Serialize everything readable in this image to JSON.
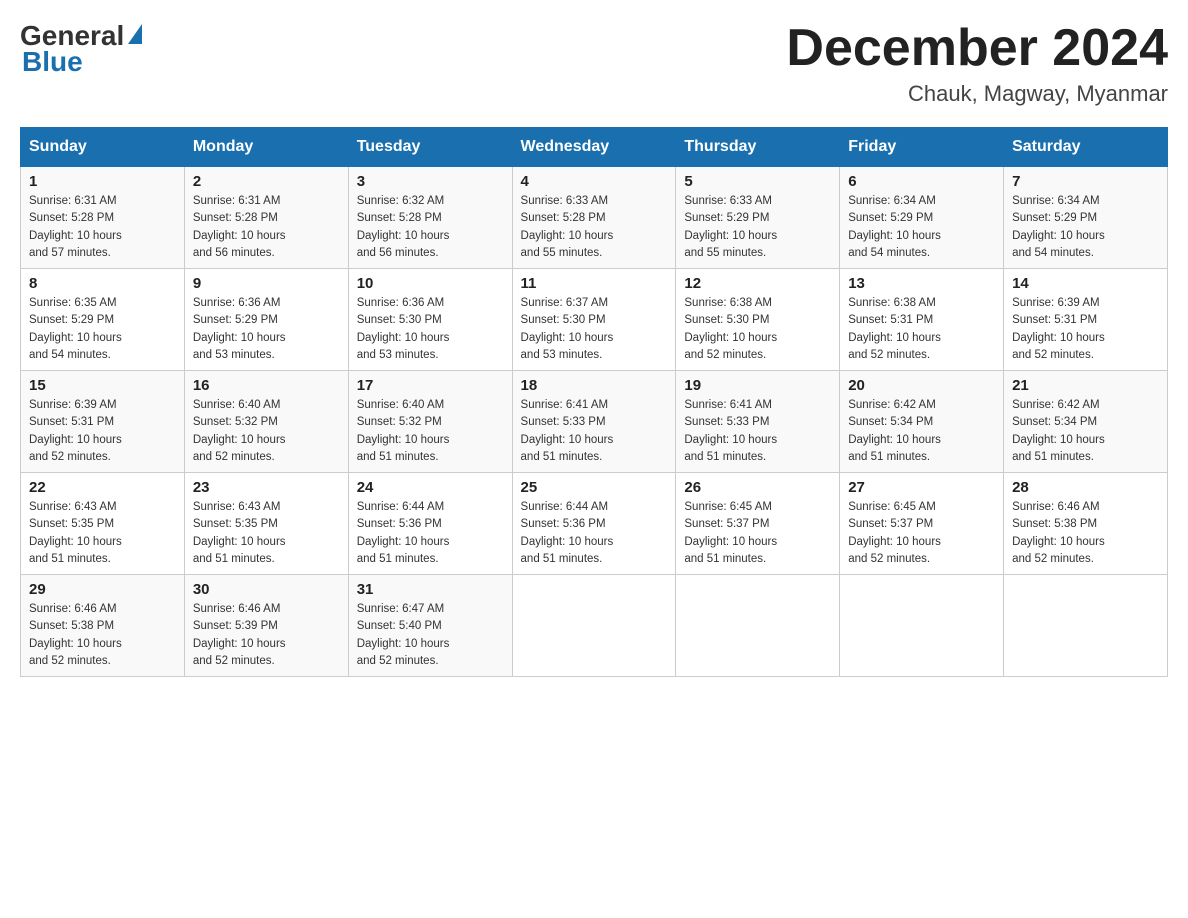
{
  "header": {
    "logo_general": "General",
    "logo_blue": "Blue",
    "month_title": "December 2024",
    "location": "Chauk, Magway, Myanmar"
  },
  "days_of_week": [
    "Sunday",
    "Monday",
    "Tuesday",
    "Wednesday",
    "Thursday",
    "Friday",
    "Saturday"
  ],
  "weeks": [
    [
      {
        "day": "1",
        "sunrise": "6:31 AM",
        "sunset": "5:28 PM",
        "daylight": "10 hours and 57 minutes."
      },
      {
        "day": "2",
        "sunrise": "6:31 AM",
        "sunset": "5:28 PM",
        "daylight": "10 hours and 56 minutes."
      },
      {
        "day": "3",
        "sunrise": "6:32 AM",
        "sunset": "5:28 PM",
        "daylight": "10 hours and 56 minutes."
      },
      {
        "day": "4",
        "sunrise": "6:33 AM",
        "sunset": "5:28 PM",
        "daylight": "10 hours and 55 minutes."
      },
      {
        "day": "5",
        "sunrise": "6:33 AM",
        "sunset": "5:29 PM",
        "daylight": "10 hours and 55 minutes."
      },
      {
        "day": "6",
        "sunrise": "6:34 AM",
        "sunset": "5:29 PM",
        "daylight": "10 hours and 54 minutes."
      },
      {
        "day": "7",
        "sunrise": "6:34 AM",
        "sunset": "5:29 PM",
        "daylight": "10 hours and 54 minutes."
      }
    ],
    [
      {
        "day": "8",
        "sunrise": "6:35 AM",
        "sunset": "5:29 PM",
        "daylight": "10 hours and 54 minutes."
      },
      {
        "day": "9",
        "sunrise": "6:36 AM",
        "sunset": "5:29 PM",
        "daylight": "10 hours and 53 minutes."
      },
      {
        "day": "10",
        "sunrise": "6:36 AM",
        "sunset": "5:30 PM",
        "daylight": "10 hours and 53 minutes."
      },
      {
        "day": "11",
        "sunrise": "6:37 AM",
        "sunset": "5:30 PM",
        "daylight": "10 hours and 53 minutes."
      },
      {
        "day": "12",
        "sunrise": "6:38 AM",
        "sunset": "5:30 PM",
        "daylight": "10 hours and 52 minutes."
      },
      {
        "day": "13",
        "sunrise": "6:38 AM",
        "sunset": "5:31 PM",
        "daylight": "10 hours and 52 minutes."
      },
      {
        "day": "14",
        "sunrise": "6:39 AM",
        "sunset": "5:31 PM",
        "daylight": "10 hours and 52 minutes."
      }
    ],
    [
      {
        "day": "15",
        "sunrise": "6:39 AM",
        "sunset": "5:31 PM",
        "daylight": "10 hours and 52 minutes."
      },
      {
        "day": "16",
        "sunrise": "6:40 AM",
        "sunset": "5:32 PM",
        "daylight": "10 hours and 52 minutes."
      },
      {
        "day": "17",
        "sunrise": "6:40 AM",
        "sunset": "5:32 PM",
        "daylight": "10 hours and 51 minutes."
      },
      {
        "day": "18",
        "sunrise": "6:41 AM",
        "sunset": "5:33 PM",
        "daylight": "10 hours and 51 minutes."
      },
      {
        "day": "19",
        "sunrise": "6:41 AM",
        "sunset": "5:33 PM",
        "daylight": "10 hours and 51 minutes."
      },
      {
        "day": "20",
        "sunrise": "6:42 AM",
        "sunset": "5:34 PM",
        "daylight": "10 hours and 51 minutes."
      },
      {
        "day": "21",
        "sunrise": "6:42 AM",
        "sunset": "5:34 PM",
        "daylight": "10 hours and 51 minutes."
      }
    ],
    [
      {
        "day": "22",
        "sunrise": "6:43 AM",
        "sunset": "5:35 PM",
        "daylight": "10 hours and 51 minutes."
      },
      {
        "day": "23",
        "sunrise": "6:43 AM",
        "sunset": "5:35 PM",
        "daylight": "10 hours and 51 minutes."
      },
      {
        "day": "24",
        "sunrise": "6:44 AM",
        "sunset": "5:36 PM",
        "daylight": "10 hours and 51 minutes."
      },
      {
        "day": "25",
        "sunrise": "6:44 AM",
        "sunset": "5:36 PM",
        "daylight": "10 hours and 51 minutes."
      },
      {
        "day": "26",
        "sunrise": "6:45 AM",
        "sunset": "5:37 PM",
        "daylight": "10 hours and 51 minutes."
      },
      {
        "day": "27",
        "sunrise": "6:45 AM",
        "sunset": "5:37 PM",
        "daylight": "10 hours and 52 minutes."
      },
      {
        "day": "28",
        "sunrise": "6:46 AM",
        "sunset": "5:38 PM",
        "daylight": "10 hours and 52 minutes."
      }
    ],
    [
      {
        "day": "29",
        "sunrise": "6:46 AM",
        "sunset": "5:38 PM",
        "daylight": "10 hours and 52 minutes."
      },
      {
        "day": "30",
        "sunrise": "6:46 AM",
        "sunset": "5:39 PM",
        "daylight": "10 hours and 52 minutes."
      },
      {
        "day": "31",
        "sunrise": "6:47 AM",
        "sunset": "5:40 PM",
        "daylight": "10 hours and 52 minutes."
      },
      null,
      null,
      null,
      null
    ]
  ],
  "labels": {
    "sunrise": "Sunrise:",
    "sunset": "Sunset:",
    "daylight": "Daylight:"
  }
}
